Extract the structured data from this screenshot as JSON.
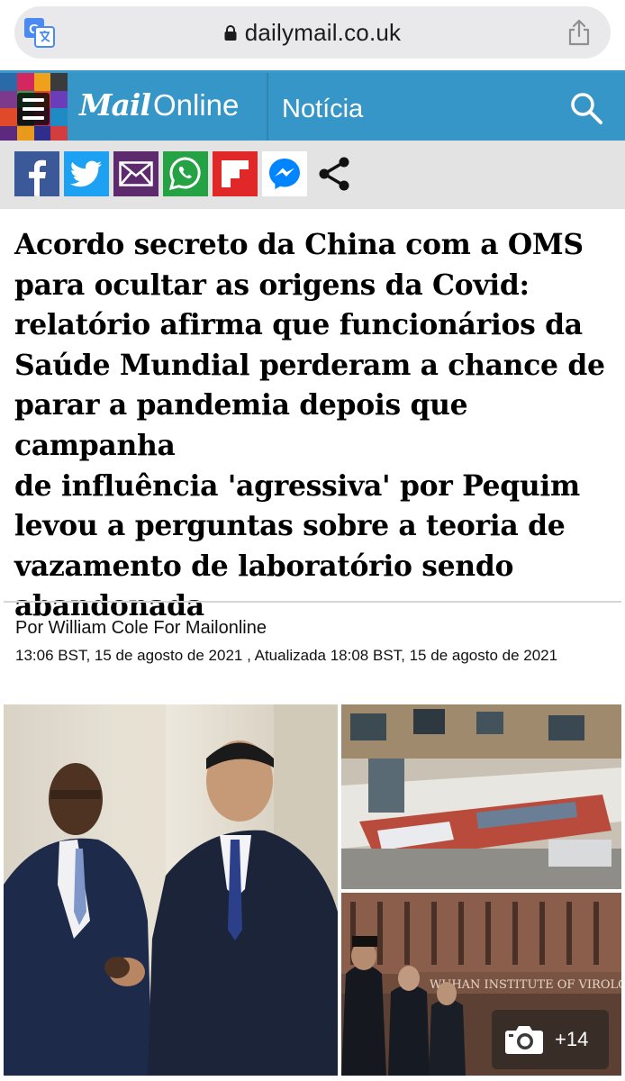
{
  "browser": {
    "url": "dailymail.co.uk",
    "translate_icon": "translate-icon",
    "lock_icon": "lock-icon",
    "share_icon": "share-icon"
  },
  "header": {
    "logo_mail": "Mail",
    "logo_online": "Online",
    "section": "Notícia",
    "menu_icon": "hamburger-menu-icon",
    "search_icon": "search-icon",
    "brand_color": "#3796c8"
  },
  "share_bar": {
    "items": [
      {
        "name": "facebook",
        "icon": "facebook-icon",
        "color": "#3b5998"
      },
      {
        "name": "twitter",
        "icon": "twitter-icon",
        "color": "#1da1f2"
      },
      {
        "name": "email",
        "icon": "email-icon",
        "color": "#5e2a6e"
      },
      {
        "name": "whatsapp",
        "icon": "whatsapp-icon",
        "color": "#25a244"
      },
      {
        "name": "flipboard",
        "icon": "flipboard-icon",
        "color": "#e12828"
      },
      {
        "name": "messenger",
        "icon": "messenger-icon",
        "color": "#0084ff"
      },
      {
        "name": "more-share",
        "icon": "share-nodes-icon",
        "color": "#111111"
      }
    ]
  },
  "article": {
    "headline_lines": [
      "Acordo secreto da China com a OMS",
      "para ocultar as origens da Covid:",
      "relatório afirma que funcionários da",
      "Saúde Mundial perderam a chance de",
      "parar a pandemia depois que campanha",
      "de influência 'agressiva' por Pequim",
      "levou a perguntas sobre a teoria de",
      "vazamento de laboratório sendo",
      "abandonada"
    ],
    "byline": "Por William Cole For Mailonline",
    "dateline": "13:06 BST, 15 de agosto de 2021 , Atualizada 18:08 BST, 15 de agosto de 2021",
    "gallery_count": "+14",
    "camera_icon": "camera-icon",
    "photo_building_sign": "WUHAN INSTITUTE OF VIROLOGY"
  }
}
